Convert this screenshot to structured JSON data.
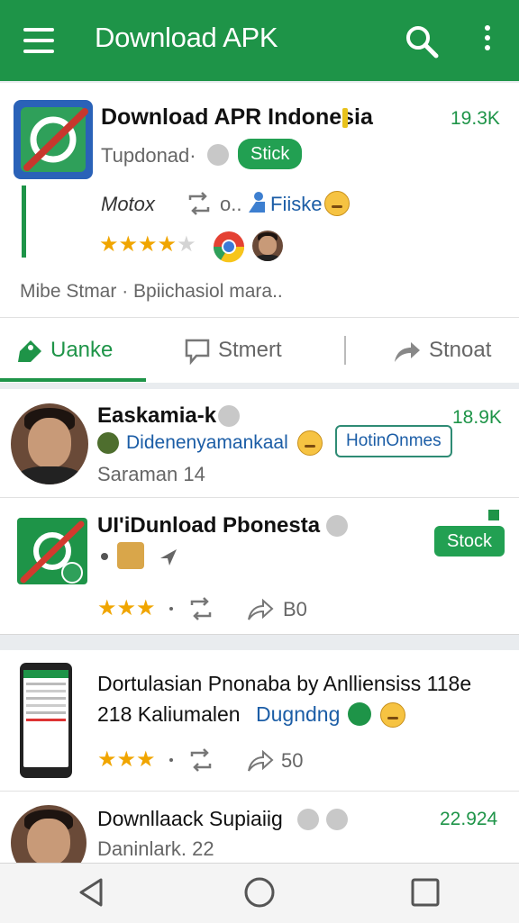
{
  "appbar": {
    "title": "Download APK",
    "icons": [
      "menu-icon",
      "search-icon",
      "more-vert-icon"
    ],
    "background": "#1e9448"
  },
  "card_a": {
    "app_name": "Download APR Indonesia",
    "count": "19.3K",
    "developer": "Tupdonad·",
    "stock_label": "Stick",
    "meta_left": "Motox",
    "meta_mid": "o..",
    "meta_right": "Fiiske",
    "rating_stars": 4,
    "rating_max": 5,
    "description": "Mibe Stmar · Bpiichasiol mara.."
  },
  "tabs": [
    {
      "label": "Uanke",
      "icon": "tag-icon",
      "active": true
    },
    {
      "label": "Stmert",
      "icon": "comment-icon",
      "active": false
    },
    {
      "label": "Stnoat",
      "icon": "share-icon",
      "active": false
    }
  ],
  "card_b": {
    "item1": {
      "name": "Easkamia-k",
      "count": "18.9K",
      "subtitle": "Didenenyamankaal",
      "badge": "HotinOnmes",
      "meta": "Saraman 14"
    },
    "item2": {
      "name": "UI'iDunload Pbonesta",
      "stock_label": "Stock",
      "rating_stars": 3,
      "reply_count": "B0"
    }
  },
  "card_c": {
    "item1": {
      "title_line1": "Dortulasian Pnonaba by Anlliensiss 118e",
      "title_line2": "218 Kaliumalen",
      "link": "Dugndng",
      "rating_stars": 3,
      "reply_count": "50"
    },
    "item2": {
      "name": "Downllaack Supiaiig",
      "count": "22.924",
      "meta": "Daninlark. 22"
    }
  },
  "navbar": {
    "icons": [
      "back-icon",
      "home-icon",
      "recents-icon"
    ]
  },
  "colors": {
    "accent": "#1e9448",
    "link": "#1b5da6",
    "star": "#f0a500"
  }
}
